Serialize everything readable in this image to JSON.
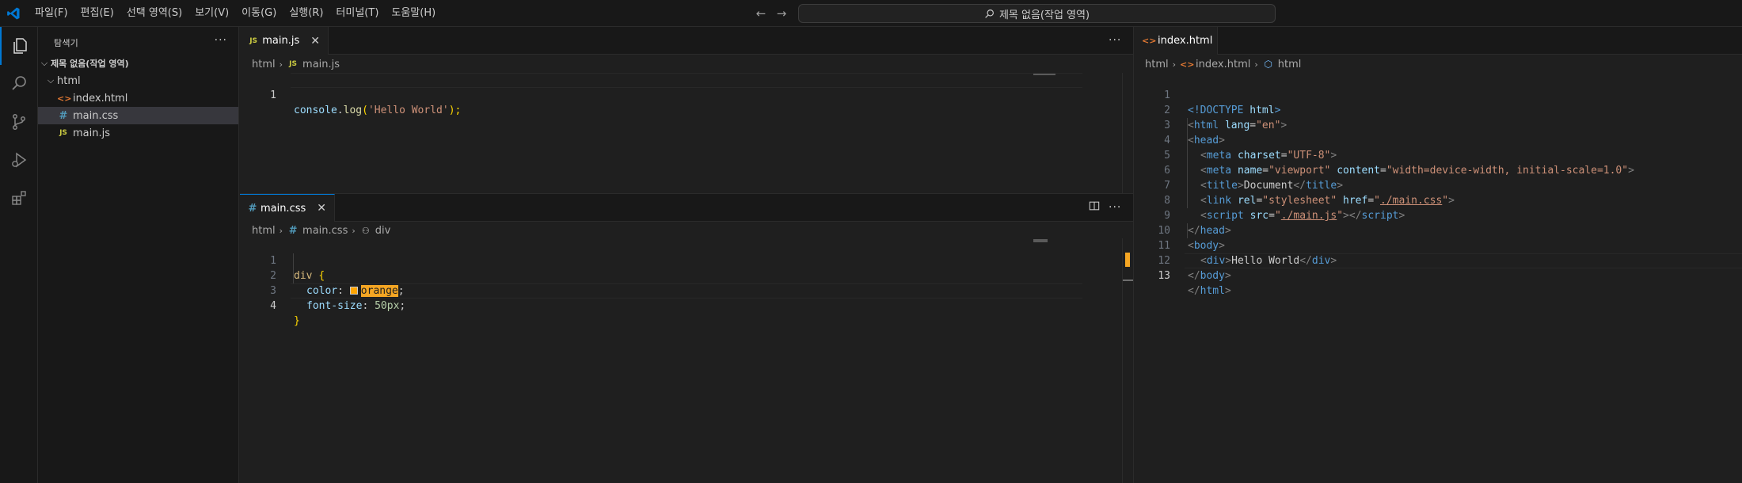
{
  "menu": [
    "파일(F)",
    "편집(E)",
    "선택 영역(S)",
    "보기(V)",
    "이동(G)",
    "실행(R)",
    "터미널(T)",
    "도움말(H)"
  ],
  "command_center": {
    "text": "제목 없음(작업 영역)"
  },
  "sidebar": {
    "title": "탐색기",
    "workspace": "제목 없음(작업 영역)",
    "folder": "html",
    "files": [
      "index.html",
      "main.css",
      "main.js"
    ],
    "selected": "main.css"
  },
  "editors": {
    "top_left": {
      "tab": "main.js",
      "breadcrumb": [
        "html",
        "main.js"
      ],
      "lines": [
        "1"
      ],
      "code": {
        "fn_obj": "console",
        "dot": ".",
        "fn": "log",
        "open": "(",
        "str": "'Hello World'",
        "close": ");"
      }
    },
    "bottom_left": {
      "tab": "main.css",
      "breadcrumb": [
        "html",
        "main.css",
        "div"
      ],
      "lines": [
        "1",
        "2",
        "3",
        "4"
      ],
      "code": {
        "selector": "div",
        "brace_open": "{",
        "prop1": "color",
        "val1": "orange",
        "prop2": "font-size",
        "val2": "50px",
        "brace_close": "}",
        "colon": ":",
        "semi": ";"
      }
    },
    "right": {
      "tab": "index.html",
      "breadcrumb": [
        "html",
        "index.html",
        "html"
      ],
      "lines": [
        "1",
        "2",
        "3",
        "4",
        "5",
        "6",
        "7",
        "8",
        "9",
        "10",
        "11",
        "12",
        "13"
      ],
      "code": {
        "doctype": "<!DOCTYPE",
        "doctype_html": "html",
        "doctype_end": ">",
        "lang_attr": "lang",
        "lang_val": "\"en\"",
        "charset_attr": "charset",
        "charset_val": "\"UTF-8\"",
        "name_attr": "name",
        "name_val": "\"viewport\"",
        "content_attr": "content",
        "content_val": "\"width=device-width, initial-scale=1.0\"",
        "title_text": "Document",
        "rel_attr": "rel",
        "rel_val": "\"stylesheet\"",
        "href_attr": "href",
        "href_q1": "\"",
        "href_val": "./main.css",
        "href_q2": "\"",
        "src_attr": "src",
        "src_q1": "\"",
        "src_val": "./main.js",
        "src_q2": "\"",
        "body_text": "Hello World"
      }
    }
  },
  "colors": {
    "accent": "#0078d4",
    "highlight": "#f5a623",
    "orange_swatch": "#ffa500"
  }
}
